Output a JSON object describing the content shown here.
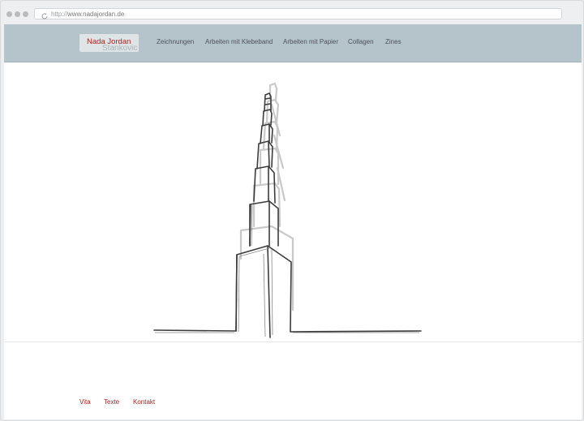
{
  "browser": {
    "url": "http://www.nadajordan.de",
    "url_prefix": "http://",
    "url_host": "www.nadajordan.de"
  },
  "site": {
    "logo": {
      "name": "Nada Jordan",
      "surname": "Stankovic"
    },
    "nav": [
      {
        "label": "Zeichnungen"
      },
      {
        "label": "Arbeiten mit Klebeband"
      },
      {
        "label": "Arbeiten mit Papier"
      },
      {
        "label": "Collagen"
      },
      {
        "label": "Zines"
      }
    ],
    "footer": [
      {
        "label": "Vita"
      },
      {
        "label": "Texte"
      },
      {
        "label": "Kontakt"
      }
    ]
  },
  "colors": {
    "accent_red": "#b3211d",
    "nav_background": "#b5c3cb"
  },
  "icons": {
    "reload": "reload-icon"
  }
}
